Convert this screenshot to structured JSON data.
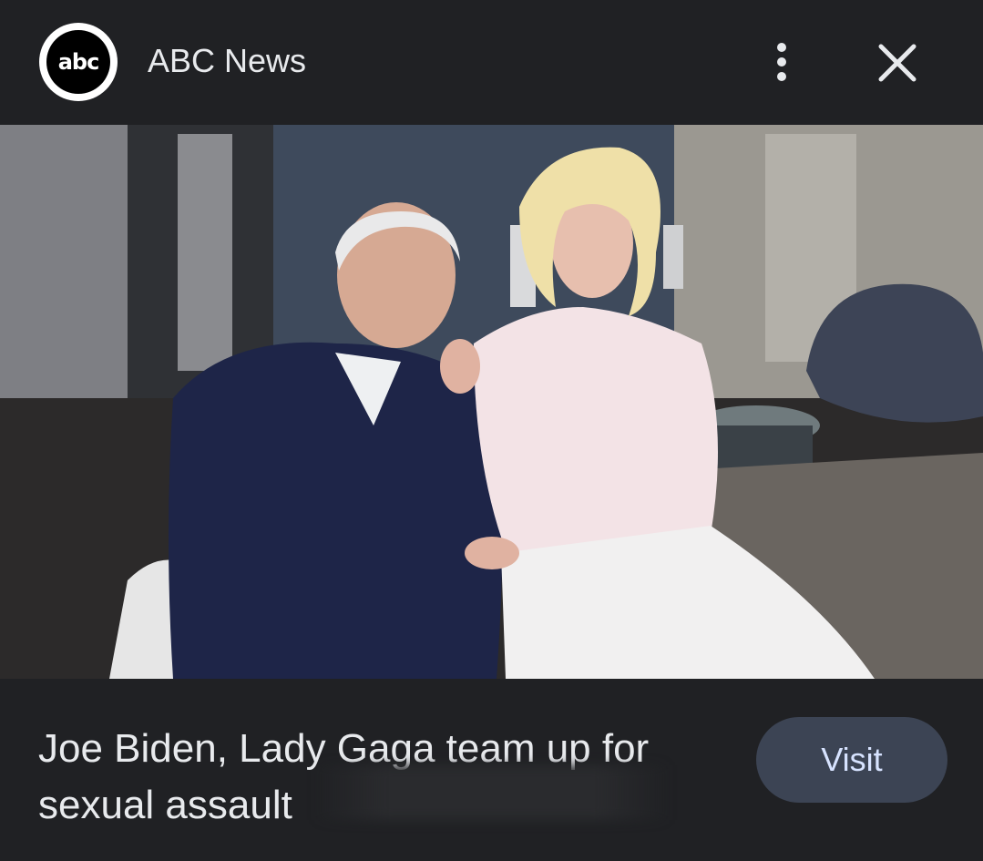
{
  "header": {
    "logo_text": "abc",
    "site_name": "ABC News",
    "more_icon": "more-vert-icon",
    "close_icon": "close-icon"
  },
  "image": {
    "lens_icon": "google-lens-icon"
  },
  "caption": {
    "title_line1": "Joe Biden, Lady Gaga team up for",
    "title_line2": "sexual assault",
    "visit_label": "Visit"
  },
  "colors": {
    "background": "#202124",
    "button_bg": "#3c4454",
    "button_text": "#d7e3ff",
    "text": "#e8eaed"
  }
}
